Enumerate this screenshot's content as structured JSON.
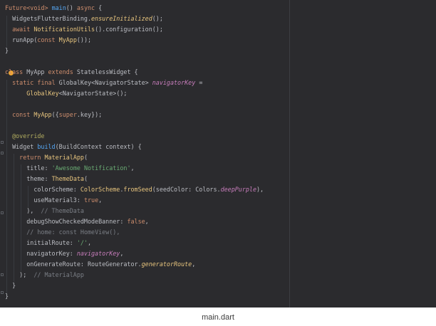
{
  "caption": "main.dart",
  "code": {
    "l1": [
      "Future",
      "<void>",
      " ",
      "main",
      "() ",
      "async",
      " {"
    ],
    "l2": [
      "  WidgetsFlutterBinding.",
      "ensureInitialized",
      "();"
    ],
    "l3": [
      "  ",
      "await",
      " ",
      "NotificationUtils",
      "().configuration();"
    ],
    "l4": [
      "  runApp(",
      "const",
      " ",
      "MyApp",
      "());"
    ],
    "l5": [
      "}"
    ],
    "l6": [
      "class",
      " MyApp ",
      "extends",
      " StatelessWidget {"
    ],
    "l7": [
      "  ",
      "static",
      " ",
      "final",
      " GlobalKey<NavigatorState> ",
      "navigatorKey",
      " ="
    ],
    "l8": [
      "      ",
      "GlobalKey",
      "<NavigatorState>();"
    ],
    "l9": [
      "  ",
      "const",
      " ",
      "MyApp",
      "({",
      "super",
      ".key});"
    ],
    "l10": [
      "  ",
      "@override"
    ],
    "l11": [
      "  Widget ",
      "build",
      "(BuildContext context) {"
    ],
    "l12": [
      "    ",
      "return",
      " ",
      "MaterialApp",
      "("
    ],
    "l13": [
      "      title: ",
      "'Awesome Notification'",
      ","
    ],
    "l14": [
      "      theme: ",
      "ThemeData",
      "("
    ],
    "l15": [
      "        colorScheme: ",
      "ColorScheme",
      ".",
      "fromSeed",
      "(seedColor: Colors.",
      "deepPurple",
      "),"
    ],
    "l16": [
      "        useMaterial3: ",
      "true",
      ","
    ],
    "l17": [
      "      ),  ",
      "// ThemeData"
    ],
    "l18": [
      "      debugShowCheckedModeBanner: ",
      "false",
      ","
    ],
    "l19": [
      "      ",
      "// home: const HomeView(),"
    ],
    "l20": [
      "      initialRoute: ",
      "'/'",
      ","
    ],
    "l21": [
      "      navigatorKey: ",
      "navigatorKey",
      ","
    ],
    "l22": [
      "      onGenerateRoute: RouteGenerator.",
      "generatorRoute",
      ","
    ],
    "l23": [
      "    );  ",
      "// MaterialApp"
    ],
    "l24": [
      "  }"
    ],
    "l25": [
      "}"
    ]
  }
}
